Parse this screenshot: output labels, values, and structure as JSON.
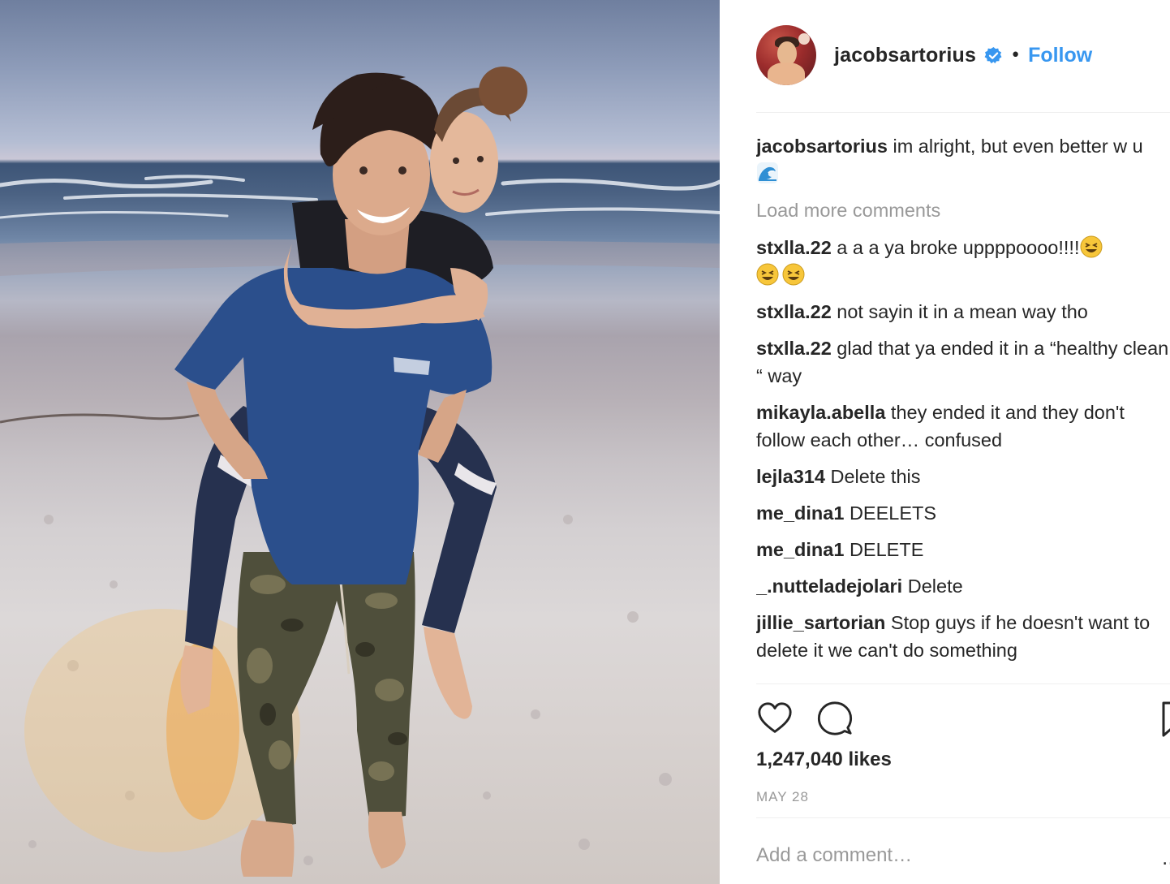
{
  "post": {
    "username": "jacobsartorius",
    "follow_label": "Follow",
    "separator": "•",
    "likes": "1,247,040 likes",
    "date": "MAY 28",
    "add_comment_placeholder": "Add a comment…",
    "load_more": "Load more comments",
    "more_glyph": "…"
  },
  "caption": {
    "username": "jacobsartorius",
    "text": " im alright, but even better w u "
  },
  "comments": [
    {
      "username": "stxlla.22",
      "text": " a a a ya broke uppppoooo!!!!"
    },
    {
      "username": "stxlla.22",
      "text": " not sayin it in a mean way tho"
    },
    {
      "username": "stxlla.22",
      "text": " glad that ya ended it in a “healthy clean “ way"
    },
    {
      "username": "mikayla.abella",
      "text": " they ended it and they don't follow each other… confused"
    },
    {
      "username": "lejla314",
      "text": " Delete this"
    },
    {
      "username": "me_dina1",
      "text": " DEELETS"
    },
    {
      "username": "me_dina1",
      "text": " DELETE"
    },
    {
      "username": "_.nutteladejolari",
      "text": " Delete"
    },
    {
      "username": "jillie_sartorian",
      "text": " Stop guys if he doesn't want to delete it we can't do something"
    }
  ],
  "colors": {
    "link_blue": "#3897f0",
    "verified_blue": "#3897f0",
    "muted_gray": "#999999",
    "text": "#262626"
  },
  "icons": [
    "verified-badge-icon",
    "heart-icon",
    "comment-icon",
    "bookmark-icon",
    "wave-emoji-icon",
    "laughing-emoji-icon"
  ]
}
